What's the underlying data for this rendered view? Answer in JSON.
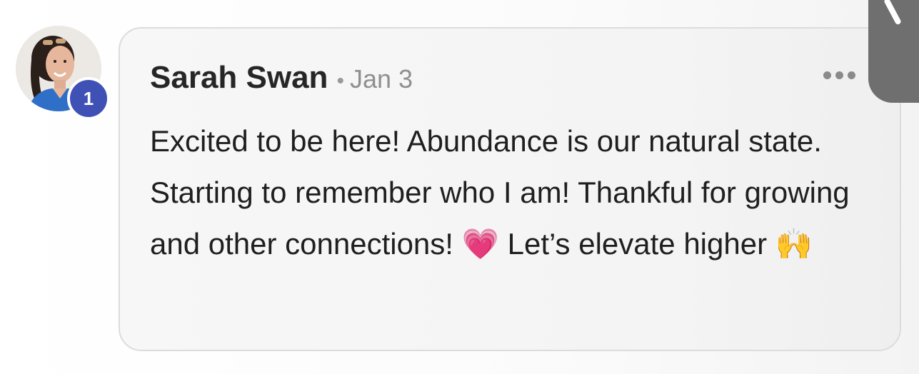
{
  "comment": {
    "author": "Sarah Swan",
    "separator": "•",
    "date": "Jan 3",
    "badge_count": "1",
    "text": "Excited to be here! Abundance is our natural state. Starting to remember who I am! Thankful for growing and other connections! 💗 Let’s elevate higher 🙌"
  },
  "icons": {
    "more": "more-horizontal-icon",
    "avatar": "user-avatar"
  },
  "colors": {
    "badge": "#3f51b5",
    "card_background": "#f5f5f5",
    "card_border": "#dcdcdc",
    "author_text": "#262626",
    "meta_text": "#8f8f8f"
  }
}
